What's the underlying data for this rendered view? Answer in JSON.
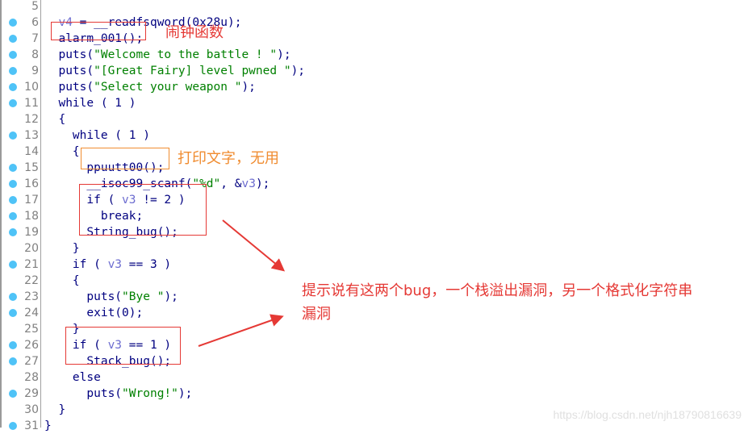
{
  "editor": {
    "lines": [
      {
        "num": "5",
        "bp": false,
        "indent": "",
        "tokens": []
      },
      {
        "num": "6",
        "bp": true,
        "indent": "  ",
        "tokens": [
          {
            "t": "v",
            "x": "v4"
          },
          {
            "t": "k",
            "x": " = __readfsqword(0x28u);"
          }
        ]
      },
      {
        "num": "7",
        "bp": true,
        "indent": "  ",
        "tokens": [
          {
            "t": "k",
            "x": "alarm_001();"
          }
        ]
      },
      {
        "num": "8",
        "bp": true,
        "indent": "  ",
        "tokens": [
          {
            "t": "k",
            "x": "puts("
          },
          {
            "t": "s",
            "x": "\"Welcome to the battle ! \""
          },
          {
            "t": "k",
            "x": ");"
          }
        ]
      },
      {
        "num": "9",
        "bp": true,
        "indent": "  ",
        "tokens": [
          {
            "t": "k",
            "x": "puts("
          },
          {
            "t": "s",
            "x": "\"[Great Fairy] level pwned \""
          },
          {
            "t": "k",
            "x": ");"
          }
        ]
      },
      {
        "num": "10",
        "bp": true,
        "indent": "  ",
        "tokens": [
          {
            "t": "k",
            "x": "puts("
          },
          {
            "t": "s",
            "x": "\"Select your weapon \""
          },
          {
            "t": "k",
            "x": ");"
          }
        ]
      },
      {
        "num": "11",
        "bp": true,
        "indent": "  ",
        "tokens": [
          {
            "t": "k",
            "x": "while ( 1 )"
          }
        ]
      },
      {
        "num": "12",
        "bp": false,
        "indent": "  ",
        "tokens": [
          {
            "t": "k",
            "x": "{"
          }
        ]
      },
      {
        "num": "13",
        "bp": true,
        "indent": "    ",
        "tokens": [
          {
            "t": "k",
            "x": "while ( 1 )"
          }
        ]
      },
      {
        "num": "14",
        "bp": false,
        "indent": "    ",
        "tokens": [
          {
            "t": "k",
            "x": "{"
          }
        ]
      },
      {
        "num": "15",
        "bp": true,
        "indent": "      ",
        "tokens": [
          {
            "t": "k",
            "x": "ppuutt00();"
          }
        ]
      },
      {
        "num": "16",
        "bp": true,
        "indent": "      ",
        "tokens": [
          {
            "t": "k",
            "x": "__isoc99_scanf("
          },
          {
            "t": "s",
            "x": "\"%d\""
          },
          {
            "t": "k",
            "x": ", &"
          },
          {
            "t": "v",
            "x": "v3"
          },
          {
            "t": "k",
            "x": ");"
          }
        ]
      },
      {
        "num": "17",
        "bp": true,
        "indent": "      ",
        "tokens": [
          {
            "t": "k",
            "x": "if ( "
          },
          {
            "t": "v",
            "x": "v3"
          },
          {
            "t": "k",
            "x": " != 2 )"
          }
        ]
      },
      {
        "num": "18",
        "bp": true,
        "indent": "        ",
        "tokens": [
          {
            "t": "k",
            "x": "break;"
          }
        ]
      },
      {
        "num": "19",
        "bp": true,
        "indent": "      ",
        "tokens": [
          {
            "t": "k",
            "x": "String_bug();"
          }
        ]
      },
      {
        "num": "20",
        "bp": false,
        "indent": "    ",
        "tokens": [
          {
            "t": "k",
            "x": "}"
          }
        ]
      },
      {
        "num": "21",
        "bp": true,
        "indent": "    ",
        "tokens": [
          {
            "t": "k",
            "x": "if ( "
          },
          {
            "t": "v",
            "x": "v3"
          },
          {
            "t": "k",
            "x": " == 3 )"
          }
        ]
      },
      {
        "num": "22",
        "bp": false,
        "indent": "    ",
        "tokens": [
          {
            "t": "k",
            "x": "{"
          }
        ]
      },
      {
        "num": "23",
        "bp": true,
        "indent": "      ",
        "tokens": [
          {
            "t": "k",
            "x": "puts("
          },
          {
            "t": "s",
            "x": "\"Bye \""
          },
          {
            "t": "k",
            "x": ");"
          }
        ]
      },
      {
        "num": "24",
        "bp": true,
        "indent": "      ",
        "tokens": [
          {
            "t": "k",
            "x": "exit(0);"
          }
        ]
      },
      {
        "num": "25",
        "bp": false,
        "indent": "    ",
        "tokens": [
          {
            "t": "k",
            "x": "}"
          }
        ]
      },
      {
        "num": "26",
        "bp": true,
        "indent": "    ",
        "tokens": [
          {
            "t": "k",
            "x": "if ( "
          },
          {
            "t": "v",
            "x": "v3"
          },
          {
            "t": "k",
            "x": " == 1 )"
          }
        ]
      },
      {
        "num": "27",
        "bp": true,
        "indent": "      ",
        "tokens": [
          {
            "t": "k",
            "x": "Stack_bug();"
          }
        ]
      },
      {
        "num": "28",
        "bp": false,
        "indent": "    ",
        "tokens": [
          {
            "t": "k",
            "x": "else"
          }
        ]
      },
      {
        "num": "29",
        "bp": true,
        "indent": "      ",
        "tokens": [
          {
            "t": "k",
            "x": "puts("
          },
          {
            "t": "s",
            "x": "\"Wrong!\""
          },
          {
            "t": "k",
            "x": ");"
          }
        ]
      },
      {
        "num": "30",
        "bp": false,
        "indent": "  ",
        "tokens": [
          {
            "t": "k",
            "x": "}"
          }
        ]
      },
      {
        "num": "31",
        "bp": true,
        "indent": "",
        "tokens": [
          {
            "t": "k",
            "x": "}"
          }
        ]
      }
    ]
  },
  "annotations": {
    "alarm_note": "闹钟函数",
    "print_note": "打印文字，无用",
    "bug_note_line1": "提示说有这两个bug，一个栈溢出漏洞，另一个格式化字符串",
    "bug_note_line2": "漏洞"
  },
  "colors": {
    "red": "#e53935",
    "orange": "#f08c30",
    "breakpoint": "#4fc3f7",
    "keyword": "#000080",
    "string": "#008000",
    "variable": "#6d6dd0"
  },
  "watermark": "https://blog.csdn.net/njh18790816639"
}
